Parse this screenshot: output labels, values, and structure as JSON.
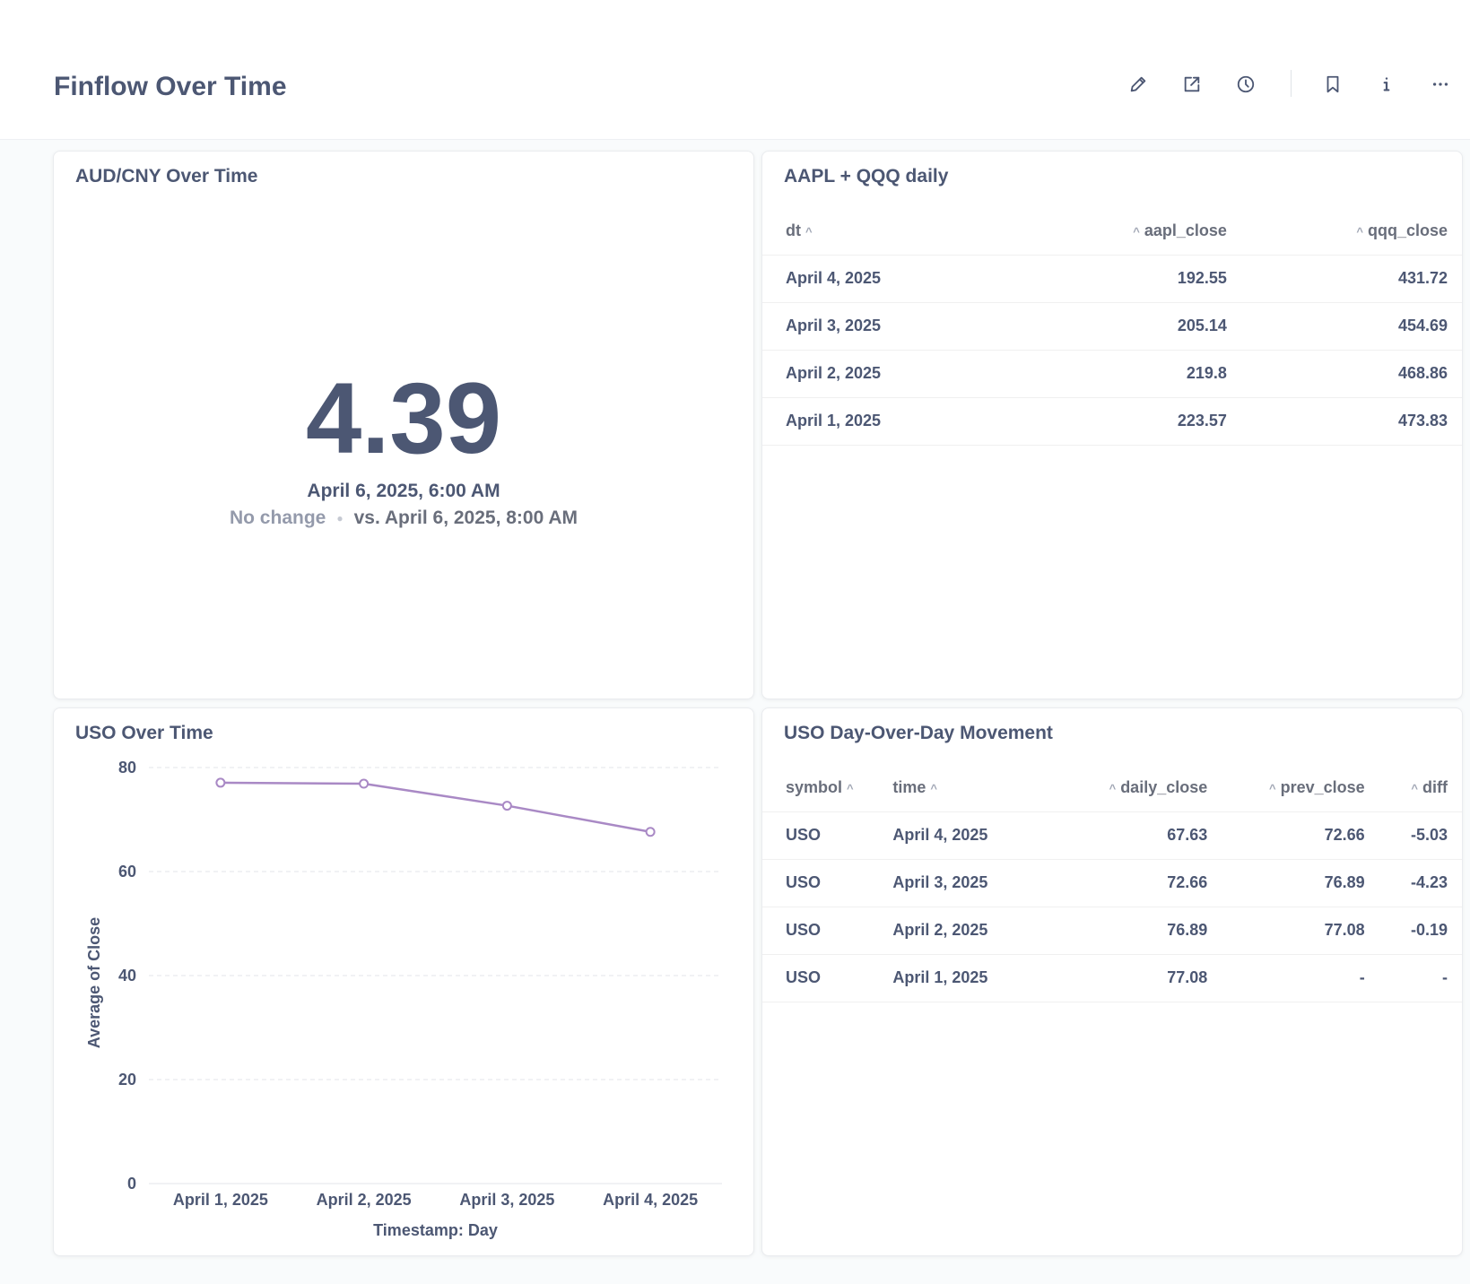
{
  "header": {
    "title": "Finflow Over Time",
    "icons": [
      "pencil-icon",
      "share-icon",
      "clock-icon",
      "bookmark-icon",
      "info-icon",
      "more-icon"
    ]
  },
  "scalar_card": {
    "title": "AUD/CNY Over Time",
    "value": "4.39",
    "date": "April 6, 2025, 6:00 AM",
    "change": "No change",
    "compare": "vs. April 6, 2025, 8:00 AM"
  },
  "aapl_table": {
    "title": "AAPL + QQQ daily",
    "columns": [
      "dt",
      "aapl_close",
      "qqq_close"
    ],
    "rows": [
      [
        "April 4, 2025",
        "192.55",
        "431.72"
      ],
      [
        "April 3, 2025",
        "205.14",
        "454.69"
      ],
      [
        "April 2, 2025",
        "219.8",
        "468.86"
      ],
      [
        "April 1, 2025",
        "223.57",
        "473.83"
      ]
    ]
  },
  "uso_table": {
    "title": "USO Day-Over-Day Movement",
    "columns": [
      "symbol",
      "time",
      "daily_close",
      "prev_close",
      "diff"
    ],
    "rows": [
      [
        "USO",
        "April 4, 2025",
        "67.63",
        "72.66",
        "-5.03"
      ],
      [
        "USO",
        "April 3, 2025",
        "72.66",
        "76.89",
        "-4.23"
      ],
      [
        "USO",
        "April 2, 2025",
        "76.89",
        "77.08",
        "-0.19"
      ],
      [
        "USO",
        "April 1, 2025",
        "77.08",
        "-",
        "-"
      ]
    ]
  },
  "uso_chart": {
    "title": "USO Over Time"
  },
  "chart_data": {
    "type": "line",
    "title": "USO Over Time",
    "xlabel": "Timestamp: Day",
    "ylabel": "Average of Close",
    "categories": [
      "April 1, 2025",
      "April 2, 2025",
      "April 3, 2025",
      "April 4, 2025"
    ],
    "series": [
      {
        "values": [
          77.08,
          76.89,
          72.66,
          67.63
        ],
        "color": "#a989c5"
      }
    ],
    "yticks": [
      0,
      20,
      40,
      60,
      80
    ],
    "ylim": [
      0,
      80
    ],
    "grid": true
  }
}
